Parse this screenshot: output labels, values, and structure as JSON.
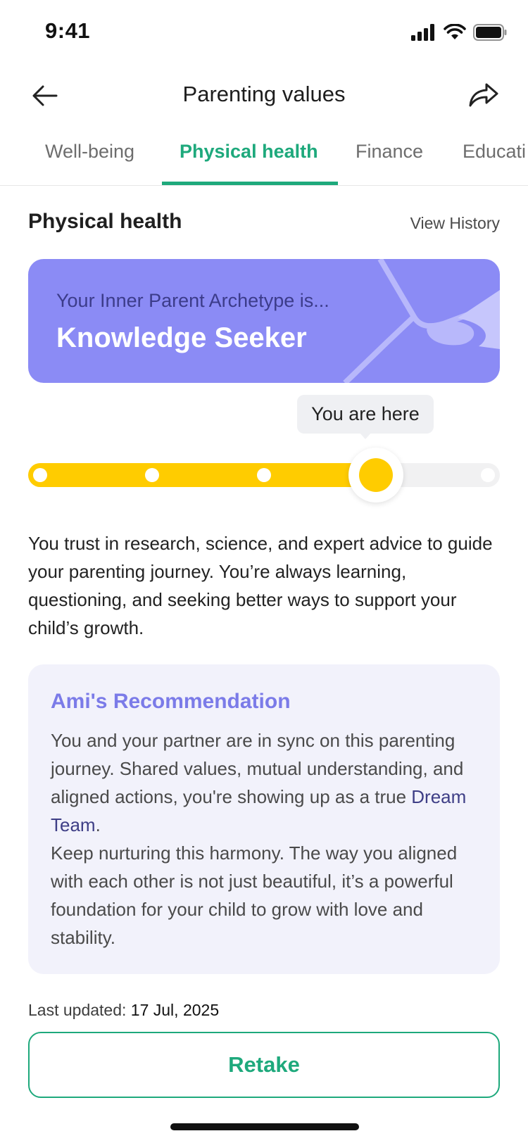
{
  "status_bar": {
    "time": "9:41"
  },
  "header": {
    "title": "Parenting values",
    "back_icon": "arrow-left-icon",
    "share_icon": "share-icon"
  },
  "tabs": [
    {
      "label": "Well-being",
      "active": false
    },
    {
      "label": "Physical health",
      "active": true
    },
    {
      "label": "Finance",
      "active": false
    },
    {
      "label": "Educati",
      "active": false
    }
  ],
  "section": {
    "title": "Physical health",
    "view_history": "View History"
  },
  "archetype": {
    "prefix": "Your Inner Parent Archetype is...",
    "name": "Knowledge Seeker",
    "card_color": "#8b8bf5"
  },
  "progress": {
    "tooltip": "You are here",
    "steps": 5,
    "current_step": 4,
    "fill_color": "#ffcc00"
  },
  "description": "You trust in research, science, and expert advice to guide your parenting journey. You’re always learning, questioning, and seeking better ways to support your child’s growth.",
  "recommendation": {
    "title": "Ami's Recommendation",
    "body_before": "You and your partner are in sync on this parenting journey. Shared values, mutual understanding, and aligned actions, you're showing up as a true ",
    "highlight": "Dream Team",
    "body_after": ".",
    "body_second": "Keep nurturing this harmony. The way you aligned with each other is not just beautiful, it’s a powerful foundation for your child to grow with love and stability."
  },
  "last_updated": {
    "label": "Last updated:",
    "date": "17 Jul, 2025"
  },
  "retake_label": "Retake",
  "colors": {
    "accent": "#1ea97c",
    "recommendation_title": "#7b7be8"
  }
}
